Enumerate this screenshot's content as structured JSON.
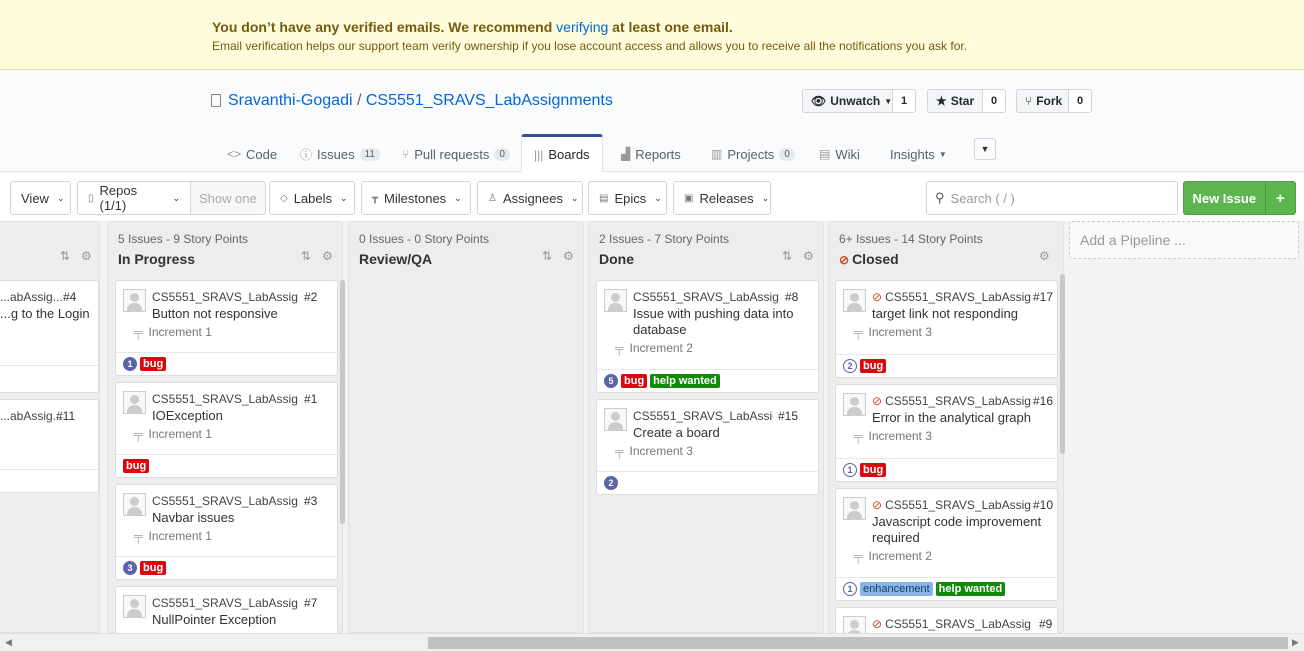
{
  "banner": {
    "line1_pre": "You don’t have any verified emails. We recommend ",
    "line1_link": "verifying",
    "line1_post": " at least one email.",
    "line2": "Email verification helps our support team verify ownership if you lose account access and allows you to receive all the notifications you ask for."
  },
  "repo": {
    "owner": "Sravanthi-Gogadi",
    "separator": "/",
    "name": "CS5551_SRAVS_LabAssignments",
    "unwatch_label": "Unwatch",
    "unwatch_count": "1",
    "star_label": "Star",
    "star_count": "0",
    "fork_label": "Fork",
    "fork_count": "0"
  },
  "tabs": [
    {
      "label": "Code",
      "count": ""
    },
    {
      "label": "Issues",
      "count": "11"
    },
    {
      "label": "Pull requests",
      "count": "0"
    },
    {
      "label": "Boards",
      "count": ""
    },
    {
      "label": "Reports",
      "count": ""
    },
    {
      "label": "Projects",
      "count": "0"
    },
    {
      "label": "Wiki",
      "count": ""
    },
    {
      "label": "Insights",
      "count": ""
    }
  ],
  "toolbar": {
    "view": "View",
    "repos": "Repos (1/1)",
    "show_one": "Show one",
    "labels": "Labels",
    "milestones": "Milestones",
    "assignees": "Assignees",
    "epics": "Epics",
    "releases": "Releases",
    "search_placeholder": "Search ( / )",
    "new_issue": "New Issue",
    "plus": "+"
  },
  "colors": {
    "bug": "#d9090f",
    "help_wanted": "#128a0c",
    "enhancement": "#84b6eb",
    "primary_green": "#5db550",
    "estimate": "#5c63a8"
  },
  "pipelines": {
    "backlog": {
      "cards": [
        {
          "repo": "...abAssig...",
          "num": "#4",
          "title": "...g to the Login"
        },
        {
          "repo": "...abAssig...",
          "num": "#11",
          "title": ""
        }
      ]
    },
    "in_progress": {
      "meta": "5 Issues - 9 Story Points",
      "title": "In Progress",
      "cards": [
        {
          "repo": "CS5551_SRAVS_LabAssign...",
          "num": "#2",
          "title": "Button not responsive",
          "milestone": "Increment 1",
          "estimate": "1",
          "labels": [
            "bug"
          ]
        },
        {
          "repo": "CS5551_SRAVS_LabAssign...",
          "num": "#1",
          "title": "IOException",
          "milestone": "Increment 1",
          "estimate": "",
          "labels": [
            "bug"
          ]
        },
        {
          "repo": "CS5551_SRAVS_LabAssign...",
          "num": "#3",
          "title": "Navbar issues",
          "milestone": "Increment 1",
          "estimate": "3",
          "labels": [
            "bug"
          ]
        },
        {
          "repo": "CS5551_SRAVS_LabAssign...",
          "num": "#7",
          "title": "NullPointer Exception"
        }
      ]
    },
    "review": {
      "meta": "0 Issues - 0 Story Points",
      "title": "Review/QA"
    },
    "done": {
      "meta": "2 Issues - 7 Story Points",
      "title": "Done",
      "cards": [
        {
          "repo": "CS5551_SRAVS_LabAssign...",
          "num": "#8",
          "title1": "Issue with pushing data into",
          "title2": "database",
          "milestone": "Increment 2",
          "estimate": "5",
          "labels": [
            "bug",
            "help wanted"
          ]
        },
        {
          "repo": "CS5551_SRAVS_LabAssig...",
          "num": "#15",
          "title": "Create a board",
          "milestone": "Increment 3",
          "estimate": "2"
        }
      ]
    },
    "closed": {
      "meta": "6+ Issues - 14 Story Points",
      "title": "Closed",
      "cards": [
        {
          "repo": "CS5551_SRAVS_LabAssig...",
          "num": "#17",
          "title": "target link not responding",
          "milestone": "Increment 3",
          "estimate": "2",
          "labels": [
            "bug"
          ]
        },
        {
          "repo": "CS5551_SRAVS_LabAssig...",
          "num": "#16",
          "title": "Error in the analytical graph",
          "milestone": "Increment 3",
          "estimate": "1",
          "labels": [
            "bug"
          ]
        },
        {
          "repo": "CS5551_SRAVS_LabAssig...",
          "num": "#10",
          "title1": "Javascript code improvement",
          "title2": "required",
          "milestone": "Increment 2",
          "estimate": "1",
          "labels": [
            "enhancement",
            "help wanted"
          ]
        },
        {
          "repo": "CS5551_SRAVS_LabAssig...",
          "num": "#9"
        }
      ]
    },
    "add_pipeline": "Add a Pipeline ..."
  }
}
